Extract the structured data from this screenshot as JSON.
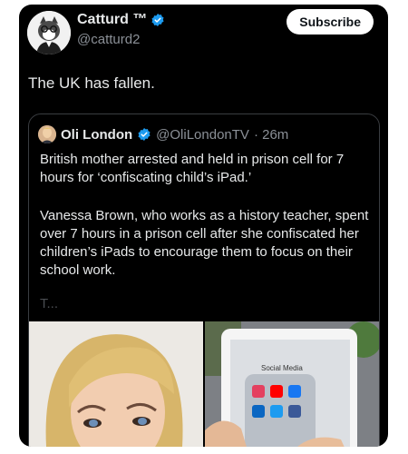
{
  "author": {
    "name": "Catturd ™",
    "handle": "@catturd2"
  },
  "subscribe_label": "Subscribe",
  "tweet_text": "The UK has fallen.",
  "quote": {
    "name": "Oli London",
    "handle": "@OliLondonTV",
    "time": "· 26m",
    "paragraph1": "British mother arrested and held in prison cell for 7 hours for ‘confiscating child’s iPad.’",
    "paragraph2": "Vanessa Brown, who works as a history teacher, spent over 7 hours in a prison cell after she confiscated her children’s iPads to encourage them to focus on their school work.",
    "show_more": "T...",
    "media_label": "Social Media"
  },
  "icons": {
    "verified": "verified-badge-icon"
  },
  "colors": {
    "verified": "#1d9bf0",
    "background": "#000000",
    "text": "#e7e9ea",
    "muted": "#8b9097"
  }
}
